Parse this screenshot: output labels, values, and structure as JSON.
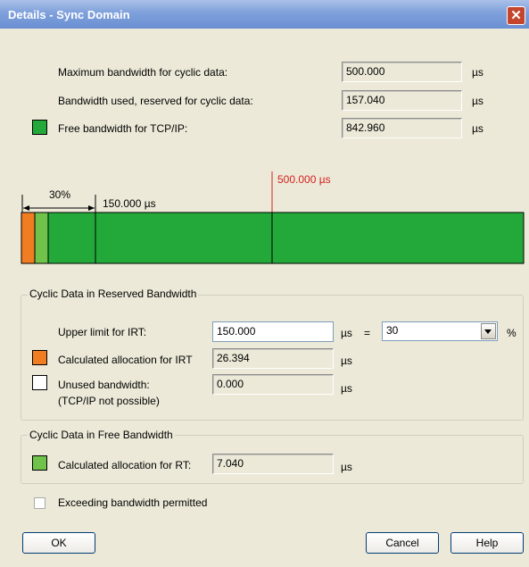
{
  "window": {
    "title": "Details - Sync Domain",
    "close_glyph": "✕"
  },
  "bandwidth": {
    "max_label": "Maximum bandwidth for cyclic data:",
    "max_value": "500.000",
    "max_unit": "µs",
    "used_label": "Bandwidth used, reserved for cyclic data:",
    "used_value": "157.040",
    "used_unit": "µs",
    "free_label": "Free bandwidth for TCP/IP:",
    "free_value": "842.960",
    "free_unit": "µs",
    "free_color": "#22a93a"
  },
  "bar": {
    "pct_label": "30%",
    "limit_label": "150.000 µs",
    "max_marker_label": "500.000 µs",
    "colors": {
      "irt": "#f07d22",
      "rt": "#6fc24a",
      "free": "#22a93a",
      "marker": "#d2221e"
    }
  },
  "reserved": {
    "legend": "Cyclic Data in Reserved Bandwidth",
    "upper_label": "Upper limit for IRT:",
    "upper_value": "150.000",
    "upper_unit": "µs",
    "equals": "=",
    "percent_value": "30",
    "percent_unit": "%",
    "irt_label": "Calculated allocation for IRT",
    "irt_value": "26.394",
    "irt_unit": "µs",
    "unused_label": "Unused bandwidth:",
    "unused_note": "(TCP/IP not possible)",
    "unused_value": "0.000",
    "unused_unit": "µs"
  },
  "free_section": {
    "legend": "Cyclic Data in Free Bandwidth",
    "rt_label": "Calculated allocation for RT:",
    "rt_value": "7.040",
    "rt_unit": "µs"
  },
  "exceed": {
    "label": "Exceeding bandwidth permitted",
    "checked": false
  },
  "buttons": {
    "ok": "OK",
    "cancel": "Cancel",
    "help": "Help"
  }
}
